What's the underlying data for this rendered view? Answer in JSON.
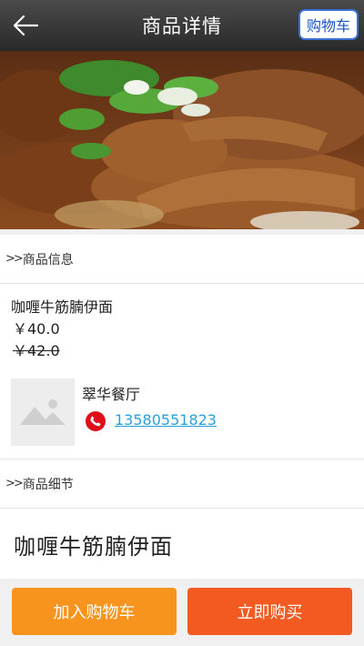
{
  "header": {
    "title": "商品详情",
    "cart_label": "购物车"
  },
  "section_info": {
    "arrow": ">>",
    "label": "商品信息"
  },
  "product": {
    "name": "咖喱牛筋腩伊面",
    "price": "￥40.0",
    "original_price": "￥42.0"
  },
  "shop": {
    "name": "翠华餐厅",
    "phone": "13580551823"
  },
  "section_detail": {
    "arrow": ">>",
    "label": "商品细节"
  },
  "detail": {
    "title": "咖喱牛筋腩伊面"
  },
  "actions": {
    "add_to_cart": "加入购物车",
    "buy_now": "立即购买"
  },
  "colors": {
    "header_bg": "#333333",
    "add_button": "#f7941d",
    "buy_button": "#f25a22",
    "phone_link": "#2aa0d8",
    "phone_icon": "#e0101a"
  }
}
